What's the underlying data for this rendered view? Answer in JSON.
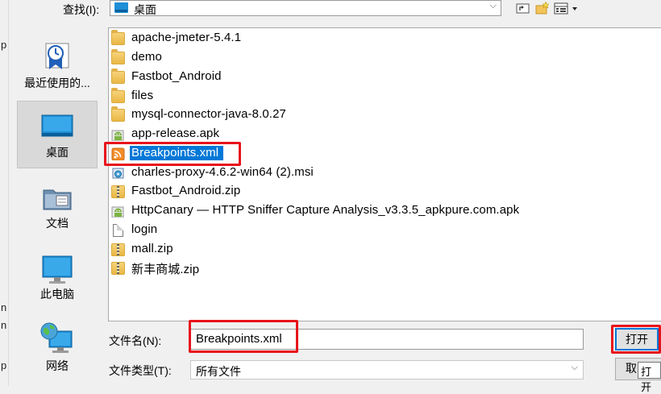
{
  "lookin": {
    "label": "查找(I):",
    "value": "桌面"
  },
  "toolbar": {
    "up_icon": "up-folder-icon",
    "new_folder_icon": "new-folder-icon",
    "view_icon": "view-menu-icon"
  },
  "places": [
    {
      "label": "最近使用的...",
      "icon": "recent-icon"
    },
    {
      "label": "桌面",
      "icon": "desktop-icon"
    },
    {
      "label": "文档",
      "icon": "documents-icon"
    },
    {
      "label": "此电脑",
      "icon": "computer-icon"
    },
    {
      "label": "网络",
      "icon": "network-icon"
    }
  ],
  "files": [
    {
      "name": "apache-jmeter-5.4.1",
      "type": "folder"
    },
    {
      "name": "demo",
      "type": "folder"
    },
    {
      "name": "Fastbot_Android",
      "type": "folder"
    },
    {
      "name": "files",
      "type": "folder"
    },
    {
      "name": "mysql-connector-java-8.0.27",
      "type": "folder"
    },
    {
      "name": "app-release.apk",
      "type": "apk"
    },
    {
      "name": "Breakpoints.xml",
      "type": "xml"
    },
    {
      "name": "charles-proxy-4.6.2-win64 (2).msi",
      "type": "msi"
    },
    {
      "name": "Fastbot_Android.zip",
      "type": "zip"
    },
    {
      "name": "HttpCanary — HTTP Sniffer Capture Analysis_v3.3.5_apkpure.com.apk",
      "type": "apk"
    },
    {
      "name": "login",
      "type": "file"
    },
    {
      "name": "mall.zip",
      "type": "zip"
    },
    {
      "name": "新丰商城.zip",
      "type": "zip"
    }
  ],
  "filename": {
    "label": "文件名(N):",
    "value": "Breakpoints.xml"
  },
  "filetype": {
    "label": "文件类型(T):",
    "value": "所有文件"
  },
  "buttons": {
    "open": "打开",
    "cancel": "取"
  },
  "tooltip": "打开",
  "left_strip": [
    "p",
    "n",
    "n",
    "p"
  ],
  "colors": {
    "selection": "#0078d7",
    "annotation": "#e8131b",
    "folder": "#e9b845"
  }
}
